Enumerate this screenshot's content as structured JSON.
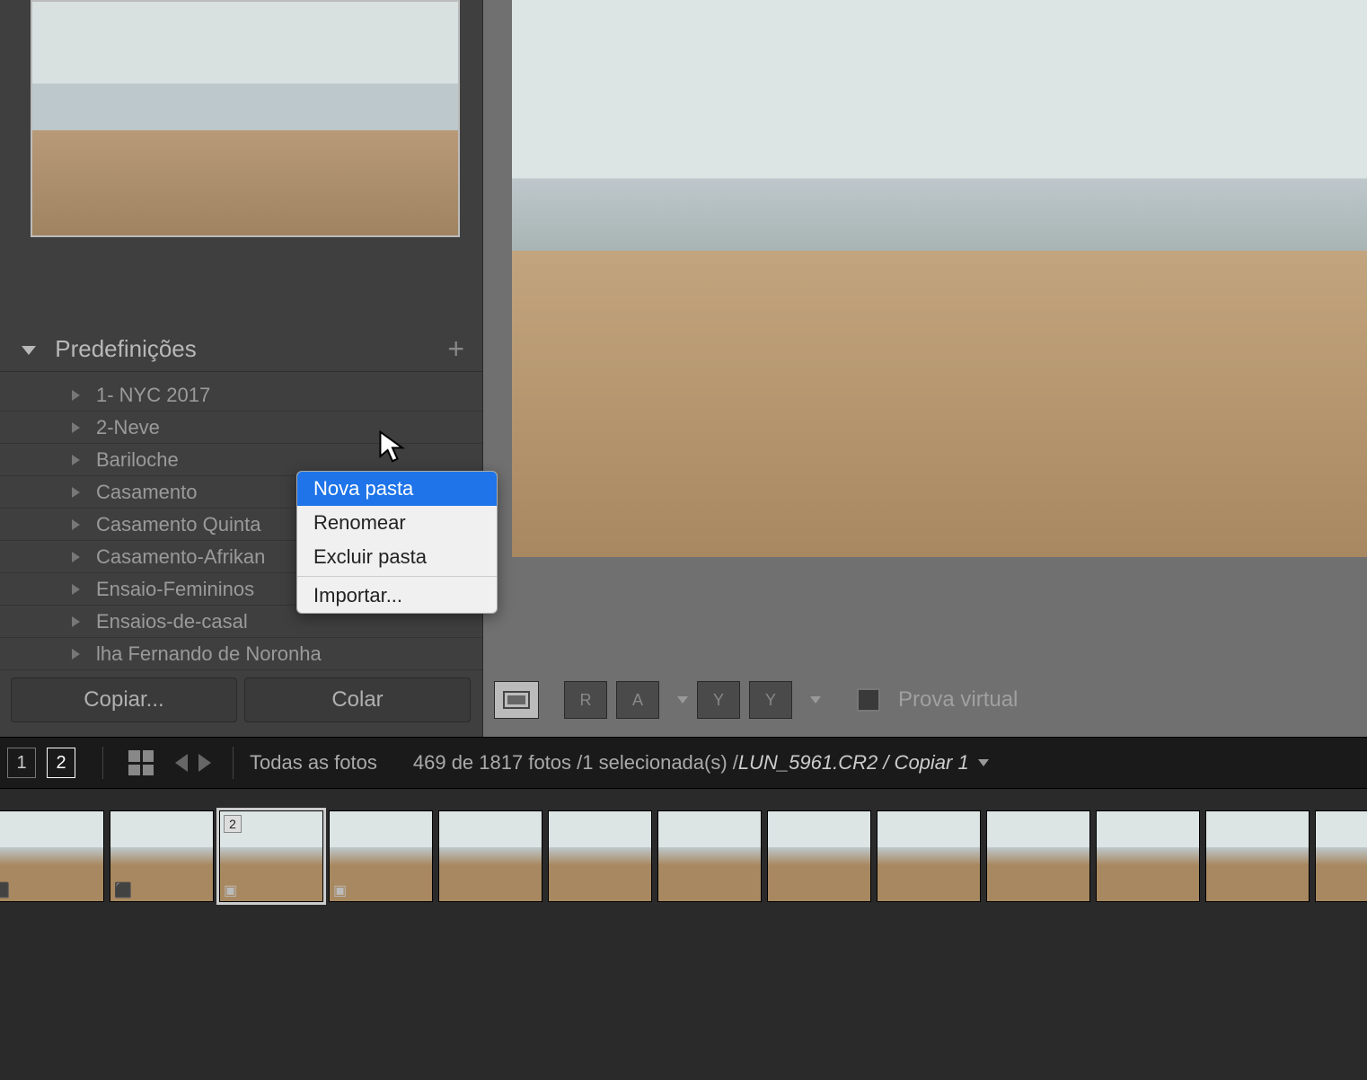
{
  "panel": {
    "title": "Predefinições",
    "items": [
      "1- NYC 2017",
      "2-Neve",
      "Bariloche",
      "Casamento",
      "Casamento Quinta",
      "Casamento-Afrikan",
      "Ensaio-Femininos",
      "Ensaios-de-casal",
      "lha Fernando de Noronha"
    ]
  },
  "buttons": {
    "copy": "Copiar...",
    "paste": "Colar"
  },
  "context_menu": {
    "new_folder": "Nova pasta",
    "rename": "Renomear",
    "delete_folder": "Excluir pasta",
    "import": "Importar..."
  },
  "toolbar": {
    "r": "R",
    "a": "A",
    "y1": "Y",
    "y2": "Y",
    "proof": "Prova virtual"
  },
  "status": {
    "view1": "1",
    "view2": "2",
    "breadcrumb": "Todas as fotos",
    "count_text": "469 de 1817 fotos /1 selecionada(s) /",
    "filename": "LUN_5961.CR2 / Copiar 1"
  },
  "filmstrip": {
    "selected_badge": "2"
  }
}
